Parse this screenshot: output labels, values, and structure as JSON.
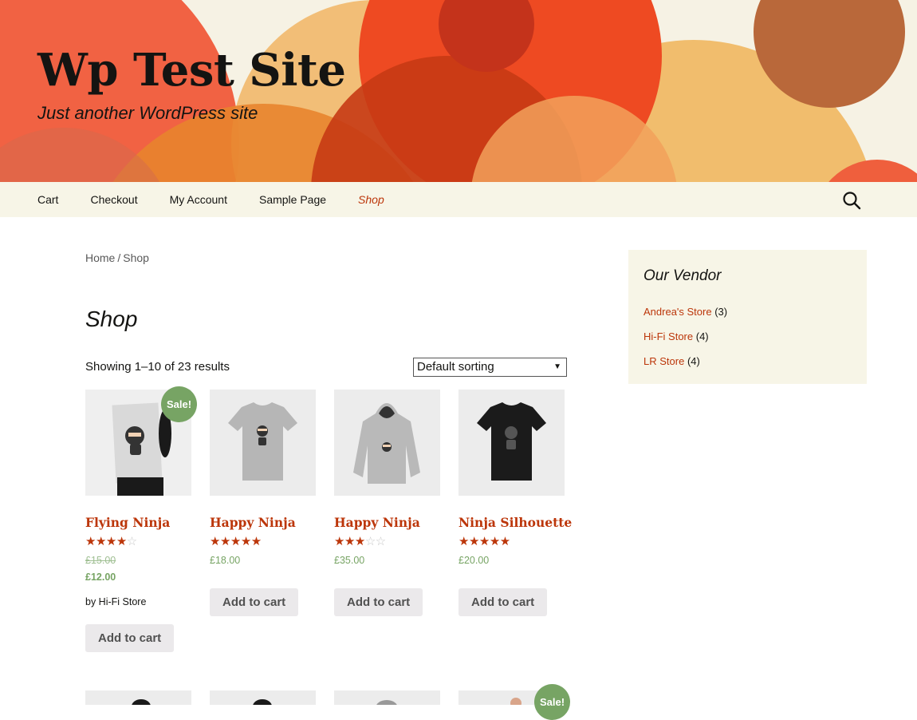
{
  "header": {
    "site_title": "Wp Test Site",
    "site_description": "Just another WordPress site"
  },
  "nav": {
    "items": [
      {
        "label": "Cart"
      },
      {
        "label": "Checkout"
      },
      {
        "label": "My Account"
      },
      {
        "label": "Sample Page"
      },
      {
        "label": "Shop",
        "active": true
      }
    ],
    "search_icon": "search-icon"
  },
  "breadcrumb": {
    "home": "Home",
    "separator": "/",
    "current": "Shop"
  },
  "page": {
    "title": "Shop",
    "result_count": "Showing 1–10 of 23 results",
    "ordering_selected": "Default sorting"
  },
  "products": [
    {
      "name": "Flying Ninja",
      "rating": 4,
      "regular_price": "£15.00",
      "sale_price": "£12.00",
      "on_sale": true,
      "sale_label": "Sale!",
      "vendor": "by Hi-Fi Store",
      "add_to_cart": "Add to cart"
    },
    {
      "name": "Happy Ninja",
      "rating": 5,
      "price": "£18.00",
      "add_to_cart": "Add to cart"
    },
    {
      "name": "Happy Ninja",
      "rating": 3,
      "price": "£35.00",
      "add_to_cart": "Add to cart"
    },
    {
      "name": "Ninja Silhouette",
      "rating": 5,
      "price": "£20.00",
      "add_to_cart": "Add to cart"
    }
  ],
  "second_row": {
    "sale_label": "Sale!"
  },
  "sidebar": {
    "widget_title": "Our Vendor",
    "vendors": [
      {
        "name": "Andrea's Store",
        "count": "(3)"
      },
      {
        "name": "Hi-Fi Store",
        "count": "(4)"
      },
      {
        "name": "LR Store",
        "count": "(4)"
      }
    ]
  },
  "colors": {
    "accent": "#bc360a",
    "price": "#77a464",
    "nav_bg": "#f7f5e7",
    "button_bg": "#ebe9eb"
  }
}
